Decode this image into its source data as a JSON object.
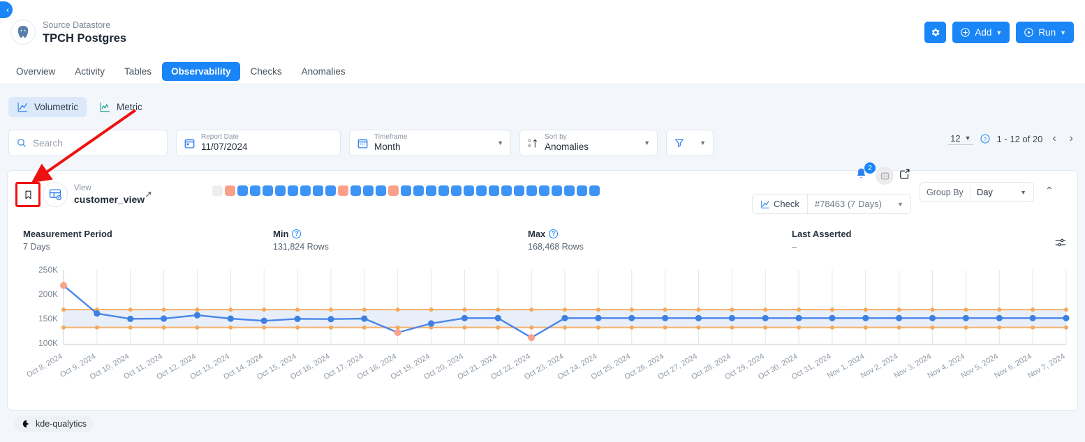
{
  "header": {
    "collapse_icon": "chevron-left-icon",
    "datastore_kind": "Source Datastore",
    "datastore_name": "TPCH Postgres",
    "logo_icon": "postgres-elephant-icon",
    "actions": {
      "settings_icon": "gear-icon",
      "add_label": "Add",
      "add_icon": "plus-circle-icon",
      "run_label": "Run",
      "run_icon": "play-circle-icon",
      "caret": "▼"
    }
  },
  "tabs": [
    {
      "label": "Overview",
      "active": false
    },
    {
      "label": "Activity",
      "active": false
    },
    {
      "label": "Tables",
      "active": false
    },
    {
      "label": "Observability",
      "active": true
    },
    {
      "label": "Checks",
      "active": false
    },
    {
      "label": "Anomalies",
      "active": false
    }
  ],
  "subtabs": [
    {
      "label": "Volumetric",
      "icon": "line-chart-icon",
      "active": true
    },
    {
      "label": "Metric",
      "icon": "metric-chart-icon",
      "active": false
    }
  ],
  "filters": {
    "search": {
      "placeholder": "Search",
      "value": "",
      "icon": "search-icon"
    },
    "report_date": {
      "label": "Report Date",
      "value": "11/07/2024",
      "icon": "calendar-icon"
    },
    "timeframe": {
      "label": "Timeframe",
      "value": "Month",
      "icon": "calendar-icon"
    },
    "sort_by": {
      "label": "Sort by",
      "value": "Anomalies",
      "icon": "sort-icon"
    },
    "filter_button": {
      "icon": "funnel-icon"
    }
  },
  "pagination": {
    "page_size": "12",
    "help_icon": "help-circle-icon",
    "range": "1 - 12 of 20",
    "prev": "‹",
    "next": "›"
  },
  "card": {
    "bookmark_icon": "bookmark-icon",
    "view_avatar_icon": "view-table-icon",
    "view_label": "View",
    "view_name": "customer_view",
    "external_link_icon": "external-link-icon",
    "status_squares": [
      "gray",
      "salmon",
      "blue",
      "blue",
      "blue",
      "blue",
      "blue",
      "blue",
      "blue",
      "blue",
      "salmon",
      "blue",
      "blue",
      "blue",
      "salmon",
      "blue",
      "blue",
      "blue",
      "blue",
      "blue",
      "blue",
      "blue",
      "blue",
      "blue",
      "blue",
      "blue",
      "blue",
      "blue",
      "blue",
      "blue",
      "blue"
    ],
    "square_colors": {
      "gray": "#eceef0",
      "salmon": "#faa08a",
      "blue": "#3d94f6"
    },
    "notification": {
      "icon": "bell-icon",
      "count": "2"
    },
    "note_icon": "note-icon",
    "edit_icon": "edit-square-icon",
    "check": {
      "icon": "line-chart-icon",
      "label": "Check",
      "value": "#78463 (7 Days)",
      "caret": "▼"
    },
    "group_by": {
      "label": "Group By",
      "value": "Day",
      "caret": "▼"
    },
    "collapse_icon": "chevron-up-icon",
    "chart_settings_icon": "sliders-icon"
  },
  "stats": [
    {
      "label": "Measurement Period",
      "value": "7 Days",
      "help": false
    },
    {
      "label": "Min",
      "value": "131,824 Rows",
      "help": true
    },
    {
      "label": "Max",
      "value": "168,468 Rows",
      "help": true
    },
    {
      "label": "Last Asserted",
      "value": "–",
      "help": false
    }
  ],
  "tag": {
    "icon": "kde-icon",
    "label": "kde-qualytics"
  },
  "chart_data": {
    "type": "line",
    "title": "",
    "xlabel": "",
    "ylabel": "",
    "ylim": [
      100000,
      250000
    ],
    "yticks": [
      100000,
      150000,
      200000,
      250000
    ],
    "ytick_labels": [
      "100K",
      "150K",
      "200K",
      "250K"
    ],
    "grid": true,
    "legend": "none",
    "band": {
      "lower": 131824,
      "upper": 168468,
      "fill": "#e8effa",
      "line_color": "#f5b678"
    },
    "point_colors": {
      "normal": "#3d80e0",
      "anomaly": "#fba28c"
    },
    "categories": [
      "Oct 8, 2024",
      "Oct 9, 2024",
      "Oct 10, 2024",
      "Oct 11, 2024",
      "Oct 12, 2024",
      "Oct 13, 2024",
      "Oct 14, 2024",
      "Oct 15, 2024",
      "Oct 16, 2024",
      "Oct 17, 2024",
      "Oct 18, 2024",
      "Oct 19, 2024",
      "Oct 20, 2024",
      "Oct 21, 2024",
      "Oct 22, 2024",
      "Oct 23, 2024",
      "Oct 24, 2024",
      "Oct 25, 2024",
      "Oct 26, 2024",
      "Oct 27, 2024",
      "Oct 28, 2024",
      "Oct 29, 2024",
      "Oct 30, 2024",
      "Oct 31, 2024",
      "Nov 1, 2024",
      "Nov 2, 2024",
      "Nov 3, 2024",
      "Nov 4, 2024",
      "Nov 5, 2024",
      "Nov 6, 2024",
      "Nov 7, 2024"
    ],
    "values": [
      218000,
      160500,
      149500,
      150000,
      157000,
      150000,
      145500,
      149500,
      149000,
      150000,
      121500,
      140000,
      151000,
      151000,
      111000,
      151000,
      151000,
      151000,
      151000,
      151000,
      151000,
      151000,
      151000,
      151000,
      151000,
      151000,
      151000,
      151000,
      151000,
      151000,
      151000
    ],
    "anomalies": [
      true,
      false,
      false,
      false,
      false,
      false,
      false,
      false,
      false,
      false,
      true,
      false,
      false,
      false,
      true,
      false,
      false,
      false,
      false,
      false,
      false,
      false,
      false,
      false,
      false,
      false,
      false,
      false,
      false,
      false,
      false
    ]
  },
  "annotation": {
    "arrow_color": "#ee1111"
  }
}
